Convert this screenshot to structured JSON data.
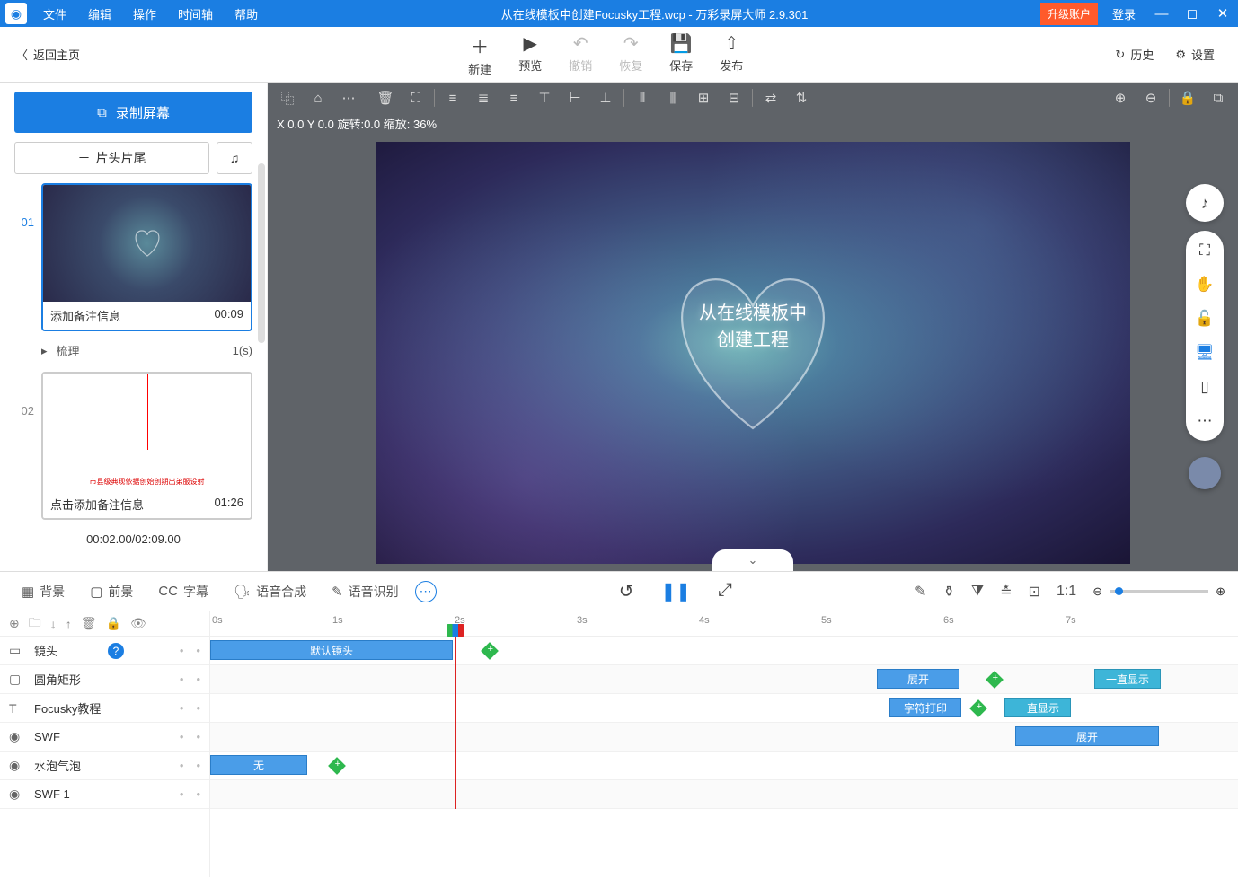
{
  "titlebar": {
    "menus": [
      "文件",
      "编辑",
      "操作",
      "时间轴",
      "帮助"
    ],
    "title": "从在线模板中创建Focusky工程.wcp - 万彩录屏大师 2.9.301",
    "upgrade": "升级账户",
    "login": "登录"
  },
  "toolbar": {
    "back": "返回主页",
    "tools": [
      {
        "ico": "＋",
        "label": "新建"
      },
      {
        "ico": "▶",
        "label": "预览"
      },
      {
        "ico": "↶",
        "label": "撤销",
        "disabled": true
      },
      {
        "ico": "↷",
        "label": "恢复",
        "disabled": true
      },
      {
        "ico": "💾",
        "label": "保存"
      },
      {
        "ico": "⇧",
        "label": "发布"
      }
    ],
    "history": "历史",
    "settings": "设置"
  },
  "sidebar": {
    "record": "录制屏幕",
    "clip": "片头片尾",
    "scenes": [
      {
        "num": "01",
        "note": "添加备注信息",
        "time": "00:09",
        "active": true,
        "thumb": "galaxy"
      },
      {
        "num": "02",
        "note": "点击添加备注信息",
        "time": "01:26",
        "active": false,
        "thumb": "blank"
      }
    ],
    "comb": {
      "label": "梳理",
      "val": "1(s)"
    },
    "timestamp": "00:02.00/02:09.00"
  },
  "canvas": {
    "status": "X 0.0 Y 0.0 旋转:0.0 缩放: 36%",
    "heart_line1": "从在线模板中",
    "heart_line2": "创建工程"
  },
  "timeline": {
    "tabs": [
      {
        "ic": "▦",
        "label": "背景"
      },
      {
        "ic": "▢",
        "label": "前景"
      },
      {
        "ic": "CC",
        "label": "字幕"
      },
      {
        "ic": "🗣",
        "label": "语音合成"
      },
      {
        "ic": "✎",
        "label": "语音识别"
      }
    ],
    "ruler": [
      "0s",
      "1s",
      "2s",
      "3s",
      "4s",
      "5s",
      "6s",
      "7s"
    ],
    "tracks": [
      {
        "ic": "▭",
        "label": "镜头",
        "help": true
      },
      {
        "ic": "▢",
        "label": "圆角矩形"
      },
      {
        "ic": "T",
        "label": "Focusky教程"
      },
      {
        "ic": "◉",
        "label": "SWF"
      },
      {
        "ic": "◉",
        "label": "水泡气泡"
      },
      {
        "ic": "◉",
        "label": "SWF 1"
      }
    ],
    "clips": {
      "default_lens": "默认镜头",
      "expand": "展开",
      "typing": "字符打印",
      "always_show": "一直显示",
      "none": "无"
    }
  }
}
